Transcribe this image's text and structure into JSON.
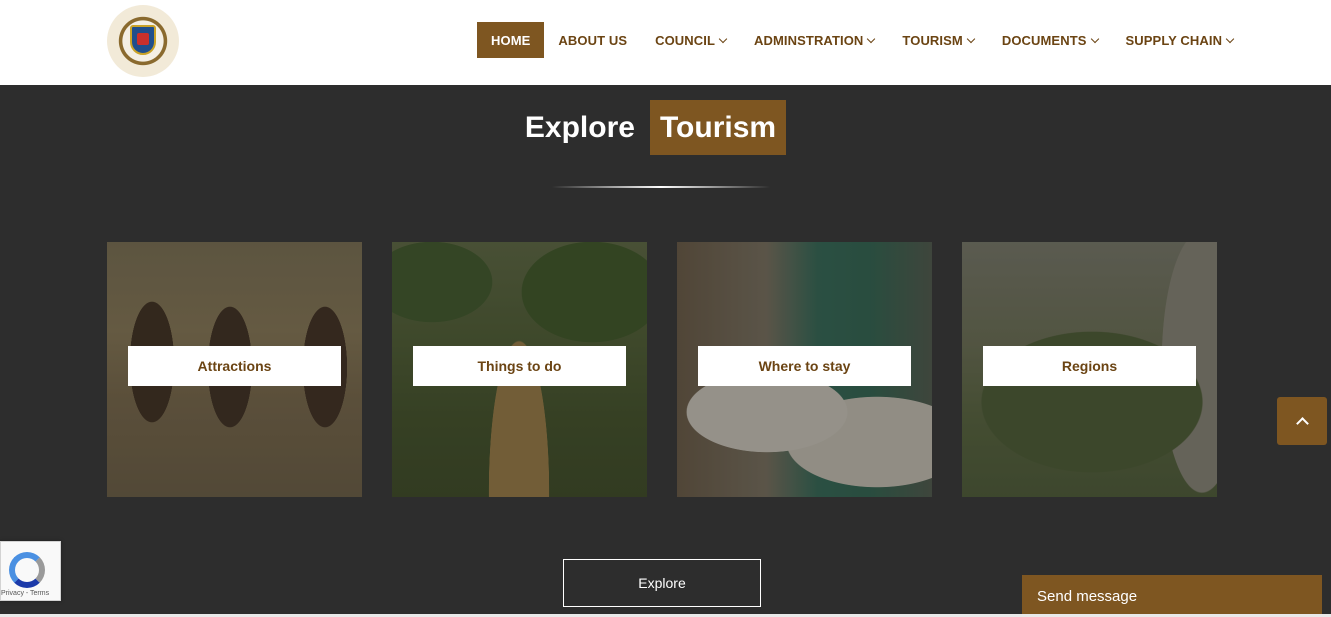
{
  "header": {
    "logo_icon": "municipal-coat-of-arms",
    "nav": [
      {
        "label": "HOME",
        "active": true,
        "dropdown": false
      },
      {
        "label": "ABOUT US",
        "active": false,
        "dropdown": false
      },
      {
        "label": "COUNCIL",
        "active": false,
        "dropdown": true
      },
      {
        "label": "ADMINSTRATION",
        "active": false,
        "dropdown": true
      },
      {
        "label": "TOURISM",
        "active": false,
        "dropdown": true
      },
      {
        "label": "DOCUMENTS",
        "active": false,
        "dropdown": true
      },
      {
        "label": "SUPPLY CHAIN",
        "active": false,
        "dropdown": true
      }
    ]
  },
  "section": {
    "title_word": "Explore",
    "title_highlight": "Tourism",
    "cards": [
      {
        "label": "Attractions"
      },
      {
        "label": "Things to do"
      },
      {
        "label": "Where to stay"
      },
      {
        "label": "Regions"
      }
    ],
    "explore_button": "Explore"
  },
  "widgets": {
    "send_message": "Send message",
    "recaptcha_text": "Privacy - Terms",
    "back_to_top_icon": "chevron-up-icon"
  },
  "colors": {
    "accent": "#7e5621",
    "background": "#2d2d2d",
    "nav_text": "#6b4413"
  }
}
